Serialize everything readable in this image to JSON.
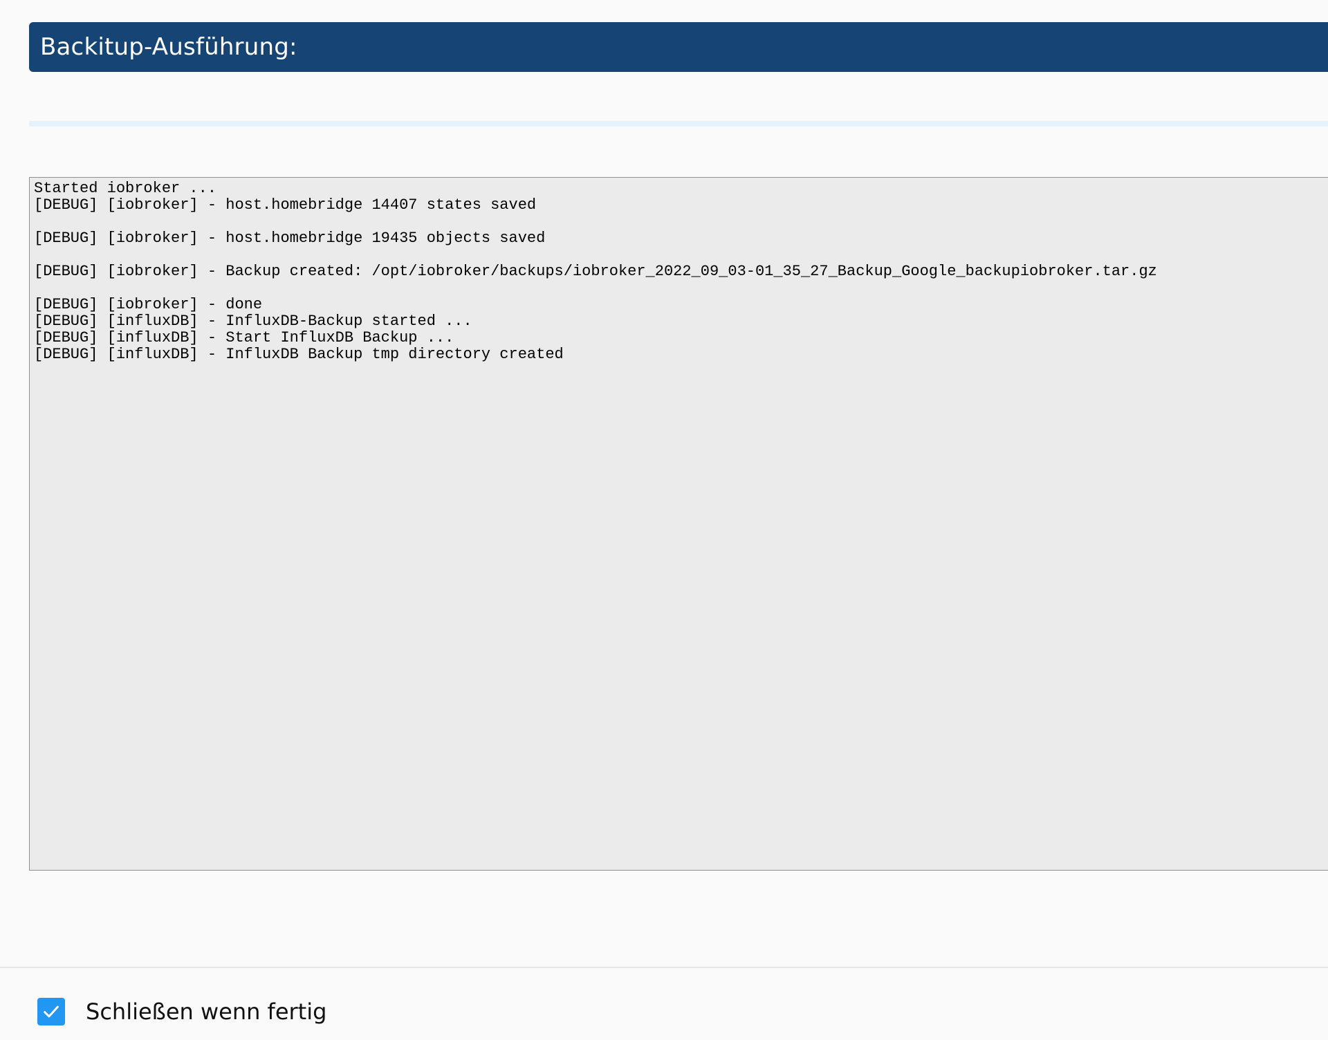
{
  "dialog": {
    "title": "Backitup-Ausführung:"
  },
  "progress": {
    "value": 0,
    "track_color": "#e3f2fd",
    "fill_color": "#90caf9"
  },
  "log": {
    "text": "Started iobroker ...\n[DEBUG] [iobroker] - host.homebridge 14407 states saved\n\n[DEBUG] [iobroker] - host.homebridge 19435 objects saved\n\n[DEBUG] [iobroker] - Backup created: /opt/iobroker/backups/iobroker_2022_09_03-01_35_27_Backup_Google_backupiobroker.tar.gz\n\n[DEBUG] [iobroker] - done\n[DEBUG] [influxDB] - InfluxDB-Backup started ...\n[DEBUG] [influxDB] - Start InfluxDB Backup ...\n[DEBUG] [influxDB] - InfluxDB Backup tmp directory created"
  },
  "footer": {
    "close_when_done": {
      "label": "Schließen wenn fertig",
      "checked": true,
      "icon": "checkmark-icon",
      "color": "#2196f3"
    }
  },
  "colors": {
    "header_bg": "#164474",
    "log_bg": "#ebebeb"
  }
}
